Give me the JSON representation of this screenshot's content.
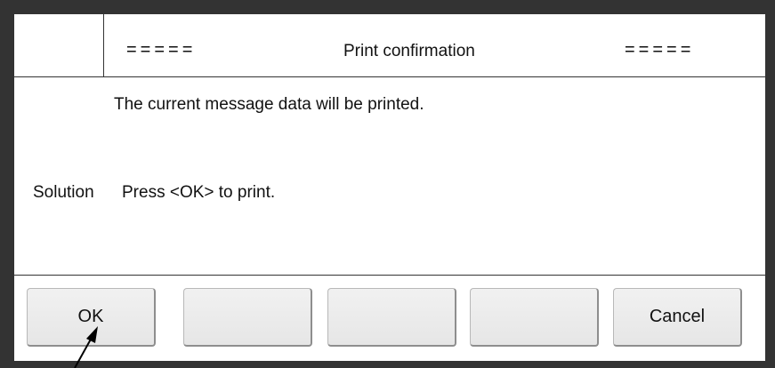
{
  "header": {
    "left_marker": "=====",
    "title": "Print confirmation",
    "right_marker": "====="
  },
  "message": {
    "text": "The current message data will be printed."
  },
  "solution": {
    "label": "Solution",
    "text": "Press <OK> to print."
  },
  "buttons": {
    "ok_label": "OK",
    "button2_label": "",
    "button3_label": "",
    "button4_label": "",
    "cancel_label": "Cancel"
  },
  "colors": {
    "frame": "#333333",
    "screen": "#ffffff",
    "button_face": "#ececec"
  },
  "icons": {
    "pointer": "arrow-pointer-icon"
  }
}
